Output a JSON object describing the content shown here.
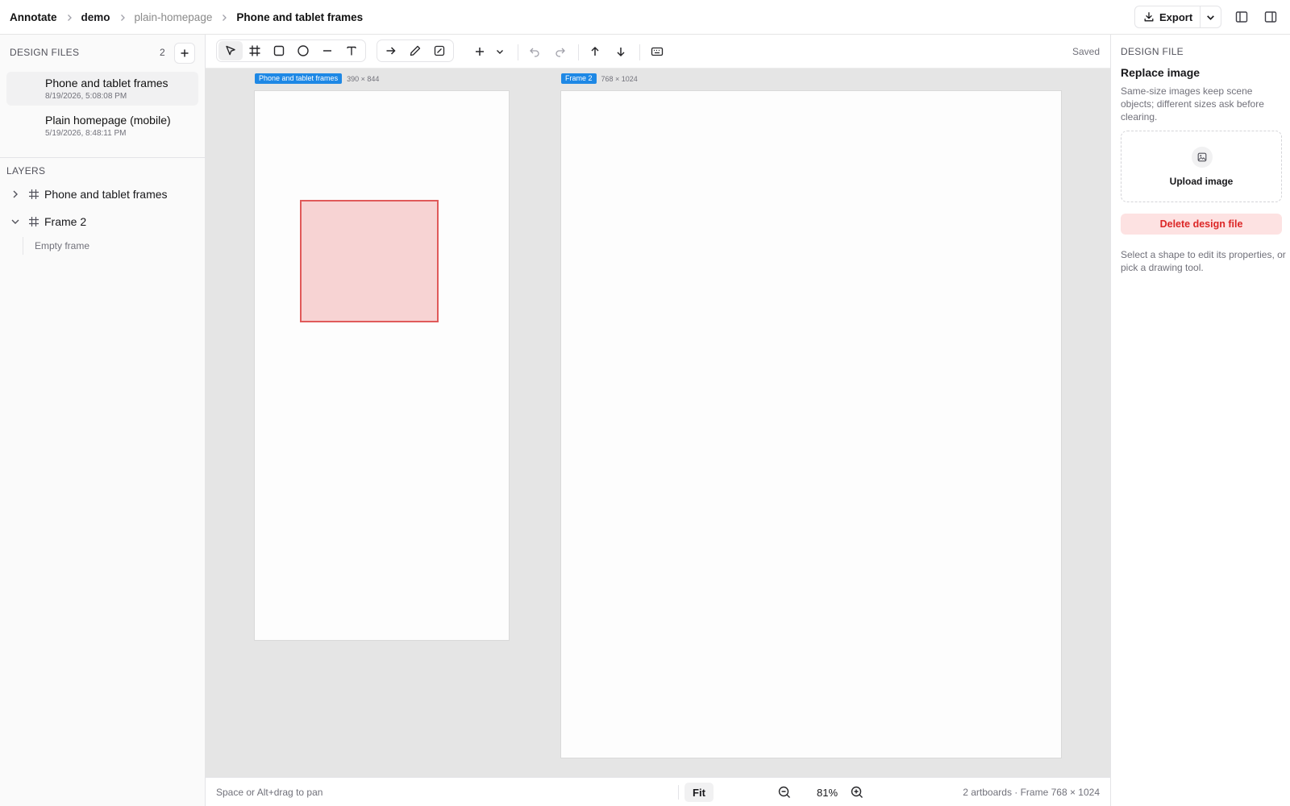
{
  "header": {
    "app_name": "Annotate",
    "breadcrumbs": [
      "demo",
      "plain-homepage",
      "Phone and tablet frames"
    ],
    "export_label": "Export"
  },
  "sidebar": {
    "design_files_title": "DESIGN FILES",
    "design_files_count": "2",
    "files": [
      {
        "name": "Phone and tablet frames",
        "date": "8/19/2026, 5:08:08 PM",
        "active": true
      },
      {
        "name": "Plain homepage (mobile)",
        "date": "5/19/2026, 8:48:11 PM",
        "active": false
      }
    ],
    "layers_title": "LAYERS",
    "layers": [
      {
        "name": "Phone and tablet frames",
        "expanded": false
      },
      {
        "name": "Frame 2",
        "expanded": true,
        "children_label": "Empty frame"
      }
    ]
  },
  "toolbar": {
    "tools": [
      "select-icon",
      "frame-icon",
      "rectangle-icon",
      "ellipse-icon",
      "line-icon",
      "text-icon",
      "arrow-icon",
      "pencil-icon",
      "image-icon",
      "plus-icon",
      "undo-icon",
      "redo-icon",
      "bring-forward-icon",
      "send-backward-icon",
      "keyboard-icon"
    ],
    "active_tool": "select",
    "save_status": "Saved"
  },
  "canvas": {
    "artboards": [
      {
        "name": "Phone and tablet frames",
        "dims": "390 × 844"
      },
      {
        "name": "Frame 2",
        "dims": "768 × 1024"
      }
    ],
    "shape_color": "#e05a5a",
    "label_color": "#1e88e5"
  },
  "footer": {
    "hint": "Space or Alt+drag to pan",
    "zoom": "81%",
    "fit_label": "Fit",
    "status": "2 artboards · Frame 768 × 1024"
  },
  "inspector": {
    "caption": "DESIGN FILE",
    "title": "Replace image",
    "description": "Same-size images keep scene objects; different sizes ask before clearing.",
    "upload_label": "Upload image",
    "delete_label": "Delete design file",
    "help": "Select a shape to edit its properties, or pick a drawing tool."
  }
}
